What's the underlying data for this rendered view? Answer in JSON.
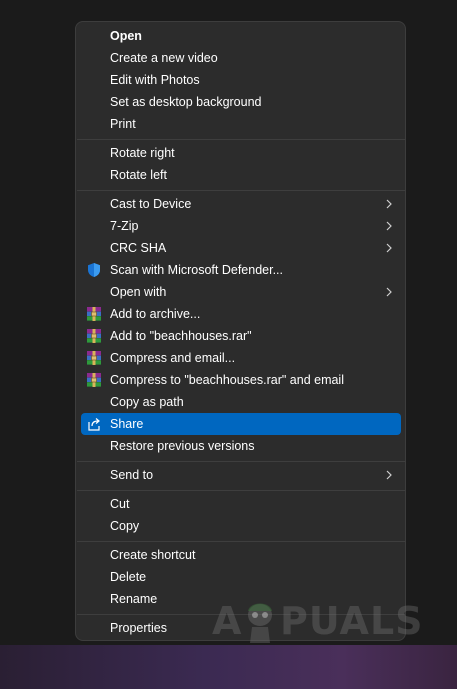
{
  "menu": {
    "items": [
      {
        "label": "Open"
      },
      {
        "label": "Create a new video"
      },
      {
        "label": "Edit with Photos"
      },
      {
        "label": "Set as desktop background"
      },
      {
        "label": "Print"
      },
      {
        "label": "Rotate right"
      },
      {
        "label": "Rotate left"
      },
      {
        "label": "Cast to Device"
      },
      {
        "label": "7-Zip"
      },
      {
        "label": "CRC SHA"
      },
      {
        "label": "Scan with Microsoft Defender..."
      },
      {
        "label": "Open with"
      },
      {
        "label": "Add to archive..."
      },
      {
        "label": "Add to \"beachhouses.rar\""
      },
      {
        "label": "Compress and email..."
      },
      {
        "label": "Compress to \"beachhouses.rar\" and email"
      },
      {
        "label": "Copy as path"
      },
      {
        "label": "Share"
      },
      {
        "label": "Restore previous versions"
      },
      {
        "label": "Send to"
      },
      {
        "label": "Cut"
      },
      {
        "label": "Copy"
      },
      {
        "label": "Create shortcut"
      },
      {
        "label": "Delete"
      },
      {
        "label": "Rename"
      },
      {
        "label": "Properties"
      }
    ]
  },
  "watermark": {
    "text_left": "A",
    "text_right": "PUALS"
  },
  "colors": {
    "menu_bg": "#2c2c2c",
    "highlight": "#0067c0",
    "text": "#ffffff",
    "separator": "#3e3e3e"
  }
}
